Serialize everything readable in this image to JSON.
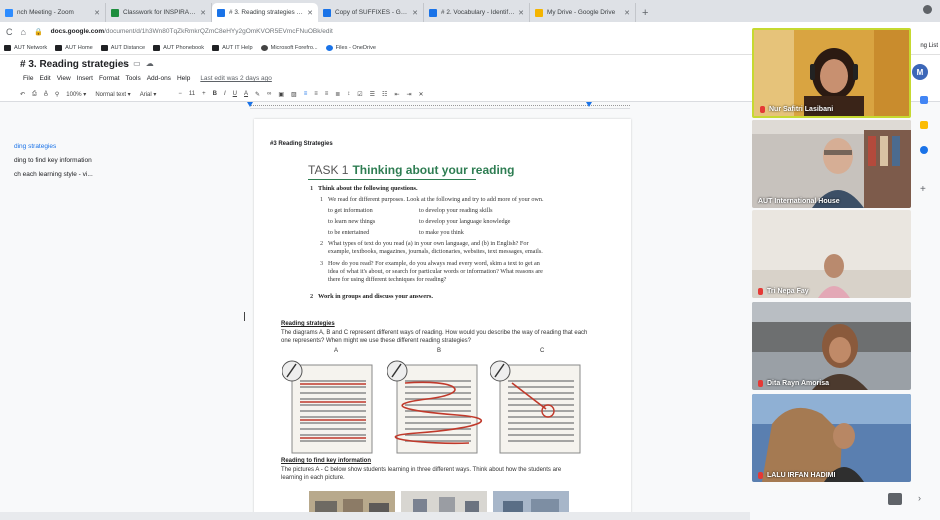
{
  "browser": {
    "tabs": [
      {
        "title": "nch Meeting - Zoom",
        "color": "#2d8cff"
      },
      {
        "title": "Classwork for INSPIRASI 2021",
        "color": "#1e8e3e"
      },
      {
        "title": "# 3. Reading strategies - Goo",
        "color": "#1a73e8"
      },
      {
        "title": "Copy of SUFFIXES - Google D",
        "color": "#1a73e8"
      },
      {
        "title": "# 2. Vocabulary - Identifying",
        "color": "#1a73e8"
      },
      {
        "title": "My Drive - Google Drive",
        "color": "#f4b400"
      }
    ],
    "new_tab": "+",
    "url_bold": "docs.google.com",
    "url_rest": "/document/d/1h3Wn80TqZkRmkrQZmC8eHYy2gOmKVOR5EVmcFNuOBk/edit",
    "bookmarks": [
      "AUT Network",
      "AUT Home",
      "AUT Distance",
      "AUT Phonebook",
      "AUT IT Help",
      "Microsoft Forefro...",
      "Files - OneDrive"
    ]
  },
  "docs": {
    "title": "# 3. Reading strategies",
    "menus": [
      "File",
      "Edit",
      "View",
      "Insert",
      "Format",
      "Tools",
      "Add-ons",
      "Help"
    ],
    "last_edit": "Last edit was 2 days ago",
    "share_label": "ng List",
    "avatar_letter": "M",
    "toolbar": {
      "zoom": "100%",
      "style": "Normal text",
      "font": "Arial",
      "size": "11"
    },
    "outline": [
      "ding strategies",
      "ding to find key information",
      "ch each learning style - vi..."
    ]
  },
  "page": {
    "heading": "#3 Reading Strategies",
    "task_label": "TASK 1",
    "task_title": "Thinking about your reading",
    "q1": "Think about the following questions.",
    "q1_1": "We read for different purposes. Look at the following and try to add more of your own.",
    "purposes": [
      [
        "to get information",
        "to develop your reading skills"
      ],
      [
        "to learn new things",
        "to develop your language knowledge"
      ],
      [
        "to be entertained",
        "to make you think"
      ]
    ],
    "q1_2a": "What types of text do you read (a) in your own language, and (b) in English? For",
    "q1_2b": "example, textbooks, magazines, journals, dictionaries, websites, text messages, emails.",
    "q1_3a": "How do you read? For example, do you always read every word, skim a text to get an",
    "q1_3b": "idea of what it's about, or search for particular words or information? What reasons are",
    "q1_3c": "there for using different techniques for reading?",
    "q2": "Work in groups and discuss your answers.",
    "strategies_title": "Reading strategies",
    "strategies_body": "The diagrams A, B and C represent different ways of reading. How would you describe the way of reading that each one represents? When might we use these different reading strategies?",
    "diagram_labels": [
      "A",
      "B",
      "C"
    ],
    "key_title": "Reading to find key information",
    "key_body": "The pictures A - C below show students learning in three different ways. Think about how the students are learning in each picture."
  },
  "participants": [
    {
      "name": "Nur Safitri Lasibani"
    },
    {
      "name": "AUT International House"
    },
    {
      "name": "Tri Nepa Fay"
    },
    {
      "name": "Dita Rayn Amorisa"
    },
    {
      "name": "LALU IRFAN HADIMI"
    }
  ]
}
